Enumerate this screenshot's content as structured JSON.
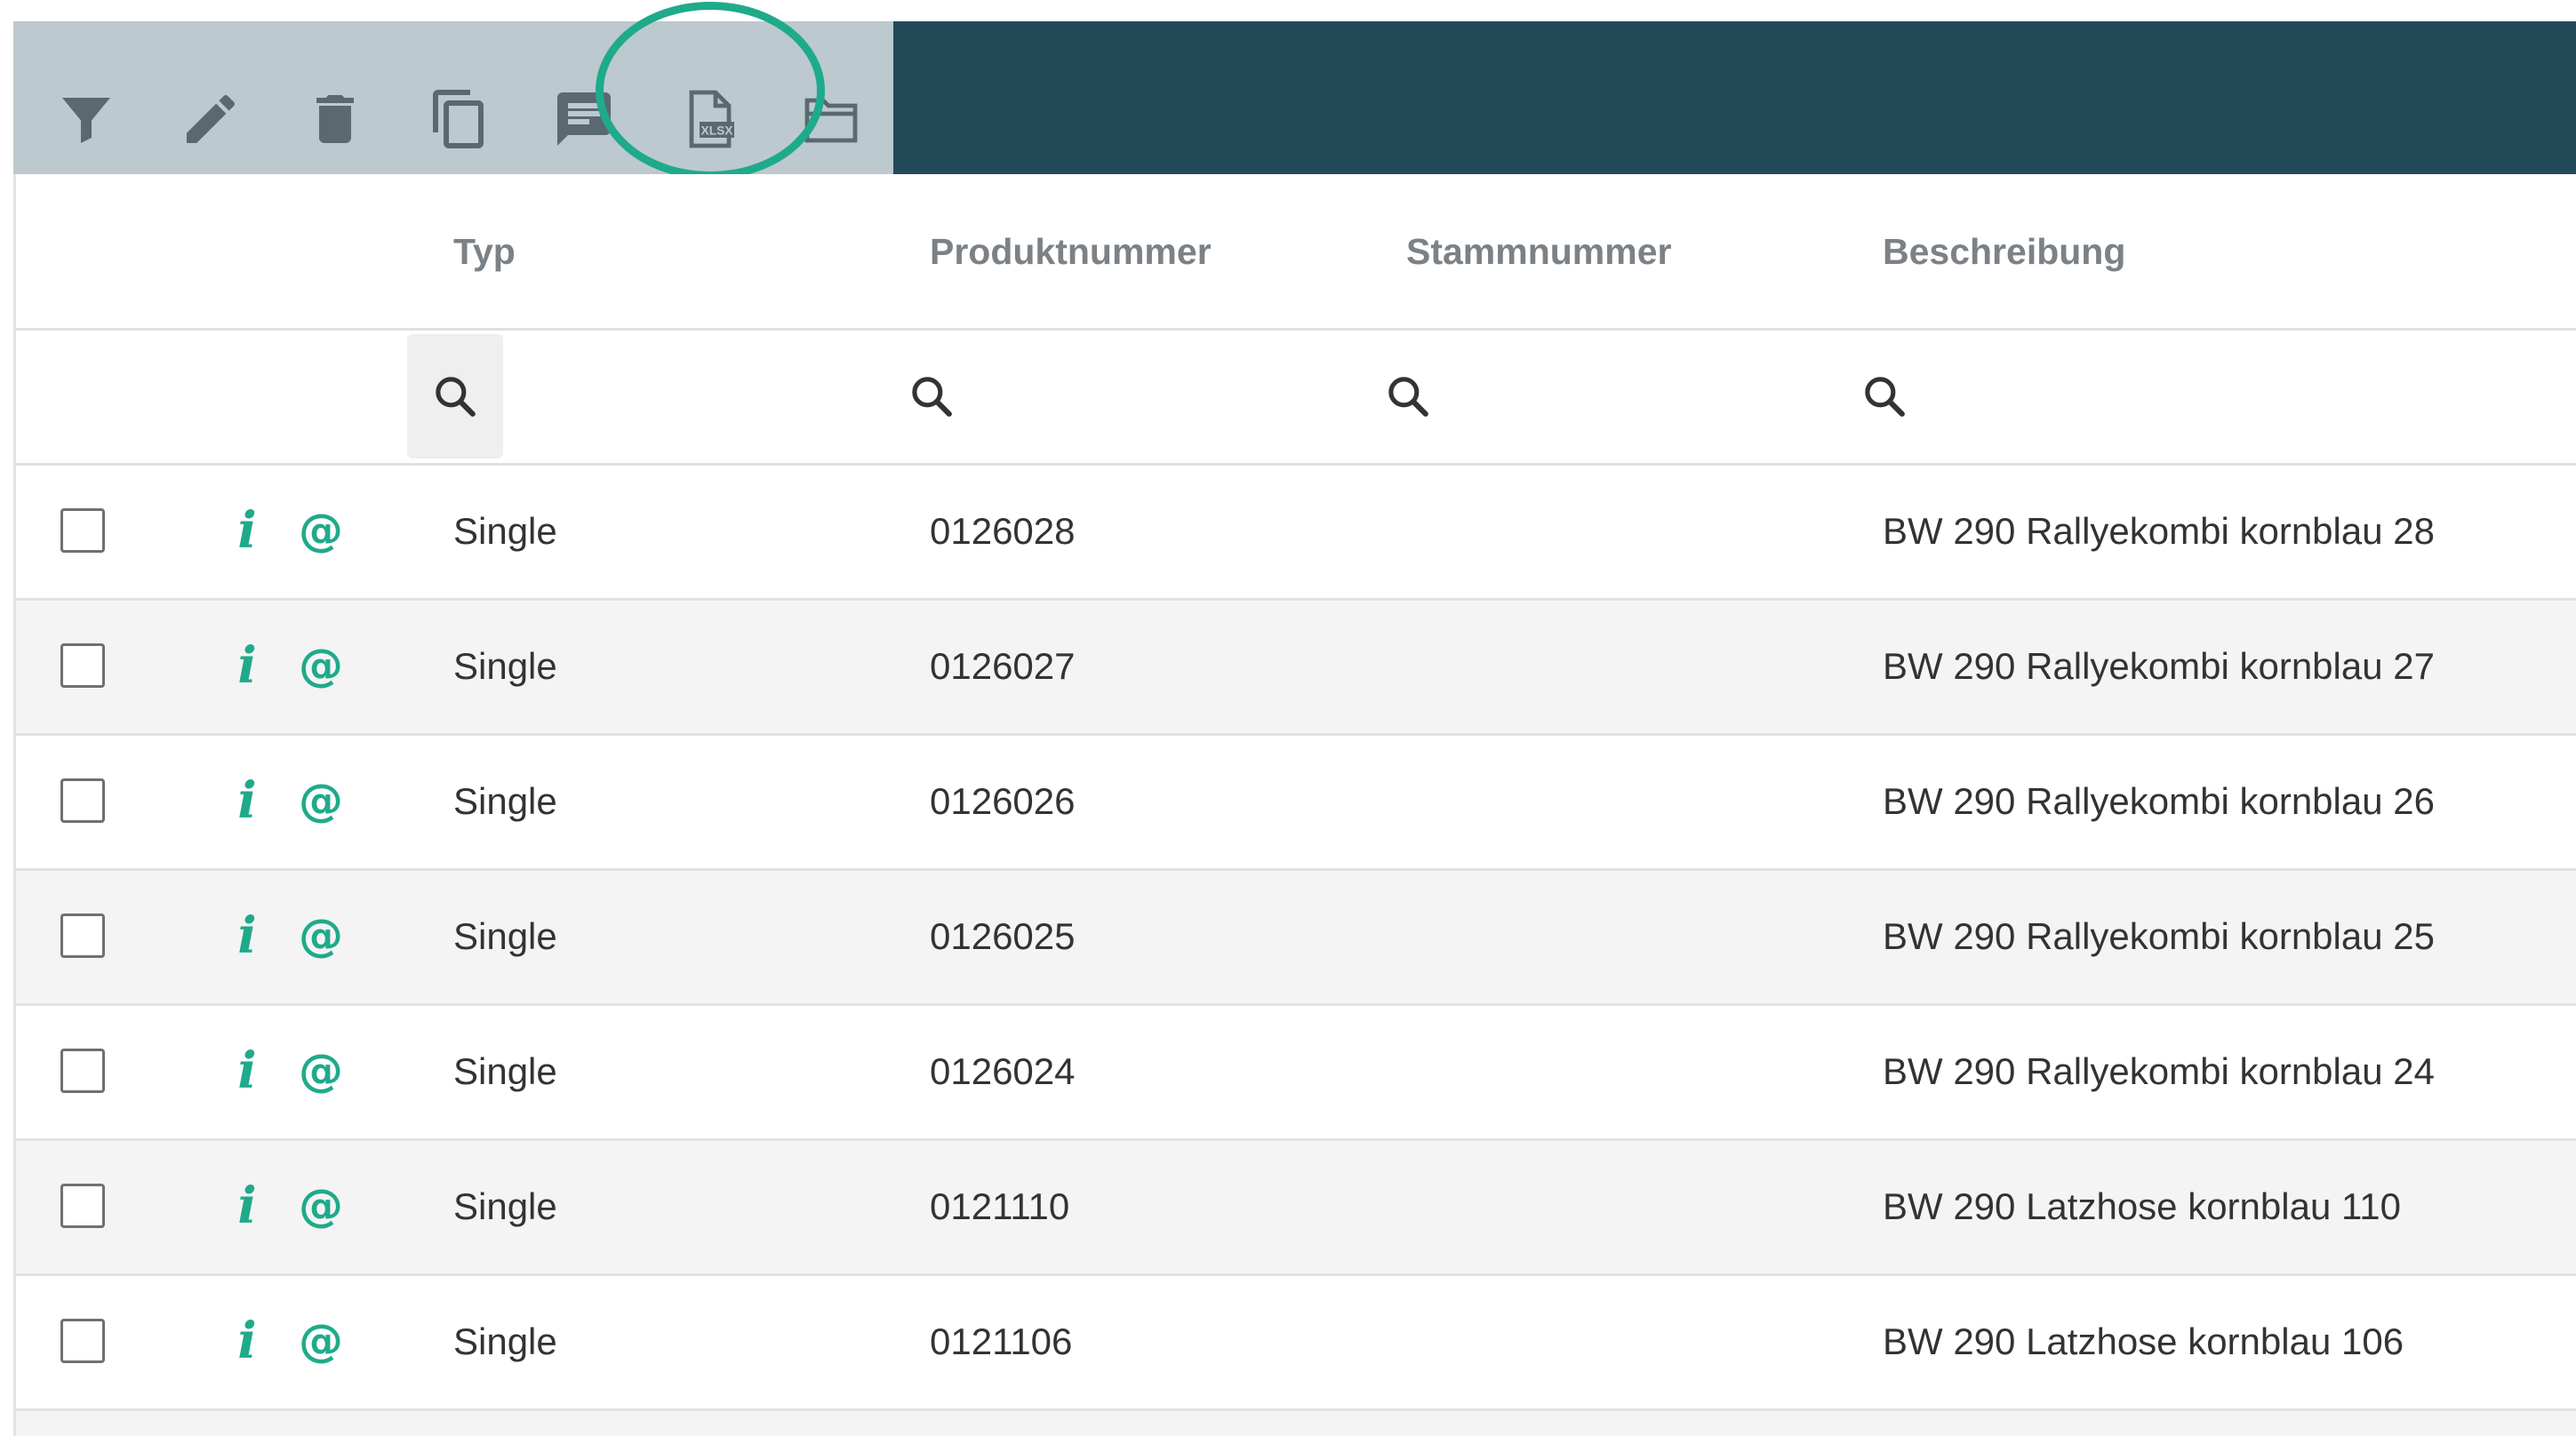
{
  "toolbar": {
    "buttons": [
      {
        "icon": "filter-icon"
      },
      {
        "icon": "pencil-icon"
      },
      {
        "icon": "trash-icon"
      },
      {
        "icon": "copy-icon"
      },
      {
        "icon": "comment-icon"
      },
      {
        "icon": "export-xlsx-icon"
      },
      {
        "icon": "folder-icon"
      }
    ],
    "xlsx_label": "XLSX",
    "colors": {
      "toolbar_bg": "#bcc9cf",
      "icon": "#5a6870",
      "topbar": "#224a58",
      "highlight": "#1faa8b"
    }
  },
  "table": {
    "columns": [
      "Typ",
      "Produktnummer",
      "Stammnummer",
      "Beschreibung"
    ],
    "rows": [
      {
        "typ": "Single",
        "produktnummer": "0126028",
        "stammnummer": "",
        "beschreibung": "BW 290 Rallyekombi kornblau 28"
      },
      {
        "typ": "Single",
        "produktnummer": "0126027",
        "stammnummer": "",
        "beschreibung": "BW 290 Rallyekombi kornblau 27"
      },
      {
        "typ": "Single",
        "produktnummer": "0126026",
        "stammnummer": "",
        "beschreibung": "BW 290 Rallyekombi kornblau 26"
      },
      {
        "typ": "Single",
        "produktnummer": "0126025",
        "stammnummer": "",
        "beschreibung": "BW 290 Rallyekombi kornblau 25"
      },
      {
        "typ": "Single",
        "produktnummer": "0126024",
        "stammnummer": "",
        "beschreibung": "BW 290 Rallyekombi kornblau 24"
      },
      {
        "typ": "Single",
        "produktnummer": "0121110",
        "stammnummer": "",
        "beschreibung": "BW 290 Latzhose kornblau 110"
      },
      {
        "typ": "Single",
        "produktnummer": "0121106",
        "stammnummer": "",
        "beschreibung": "BW 290 Latzhose kornblau 106"
      }
    ],
    "row_icons": {
      "info": "i",
      "mail": "@"
    },
    "colors": {
      "accent": "#1faa8b",
      "header_text": "#7c8186",
      "cell_text": "#333333"
    }
  }
}
